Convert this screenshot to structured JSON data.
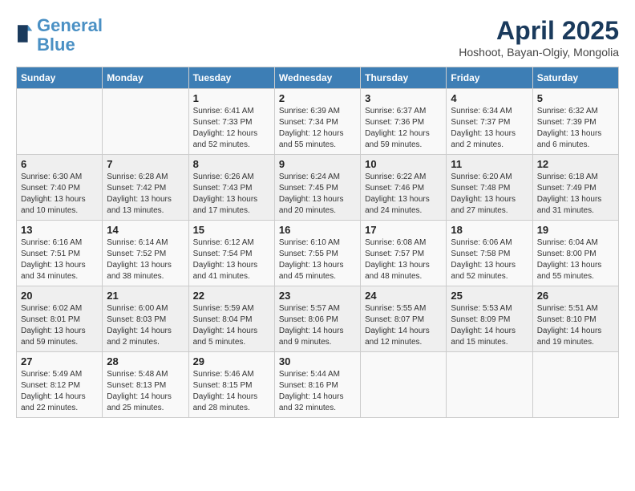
{
  "header": {
    "logo_line1": "General",
    "logo_line2": "Blue",
    "month": "April 2025",
    "location": "Hoshoot, Bayan-Olgiy, Mongolia"
  },
  "weekdays": [
    "Sunday",
    "Monday",
    "Tuesday",
    "Wednesday",
    "Thursday",
    "Friday",
    "Saturday"
  ],
  "weeks": [
    [
      {
        "day": "",
        "info": ""
      },
      {
        "day": "",
        "info": ""
      },
      {
        "day": "1",
        "info": "Sunrise: 6:41 AM\nSunset: 7:33 PM\nDaylight: 12 hours\nand 52 minutes."
      },
      {
        "day": "2",
        "info": "Sunrise: 6:39 AM\nSunset: 7:34 PM\nDaylight: 12 hours\nand 55 minutes."
      },
      {
        "day": "3",
        "info": "Sunrise: 6:37 AM\nSunset: 7:36 PM\nDaylight: 12 hours\nand 59 minutes."
      },
      {
        "day": "4",
        "info": "Sunrise: 6:34 AM\nSunset: 7:37 PM\nDaylight: 13 hours\nand 2 minutes."
      },
      {
        "day": "5",
        "info": "Sunrise: 6:32 AM\nSunset: 7:39 PM\nDaylight: 13 hours\nand 6 minutes."
      }
    ],
    [
      {
        "day": "6",
        "info": "Sunrise: 6:30 AM\nSunset: 7:40 PM\nDaylight: 13 hours\nand 10 minutes."
      },
      {
        "day": "7",
        "info": "Sunrise: 6:28 AM\nSunset: 7:42 PM\nDaylight: 13 hours\nand 13 minutes."
      },
      {
        "day": "8",
        "info": "Sunrise: 6:26 AM\nSunset: 7:43 PM\nDaylight: 13 hours\nand 17 minutes."
      },
      {
        "day": "9",
        "info": "Sunrise: 6:24 AM\nSunset: 7:45 PM\nDaylight: 13 hours\nand 20 minutes."
      },
      {
        "day": "10",
        "info": "Sunrise: 6:22 AM\nSunset: 7:46 PM\nDaylight: 13 hours\nand 24 minutes."
      },
      {
        "day": "11",
        "info": "Sunrise: 6:20 AM\nSunset: 7:48 PM\nDaylight: 13 hours\nand 27 minutes."
      },
      {
        "day": "12",
        "info": "Sunrise: 6:18 AM\nSunset: 7:49 PM\nDaylight: 13 hours\nand 31 minutes."
      }
    ],
    [
      {
        "day": "13",
        "info": "Sunrise: 6:16 AM\nSunset: 7:51 PM\nDaylight: 13 hours\nand 34 minutes."
      },
      {
        "day": "14",
        "info": "Sunrise: 6:14 AM\nSunset: 7:52 PM\nDaylight: 13 hours\nand 38 minutes."
      },
      {
        "day": "15",
        "info": "Sunrise: 6:12 AM\nSunset: 7:54 PM\nDaylight: 13 hours\nand 41 minutes."
      },
      {
        "day": "16",
        "info": "Sunrise: 6:10 AM\nSunset: 7:55 PM\nDaylight: 13 hours\nand 45 minutes."
      },
      {
        "day": "17",
        "info": "Sunrise: 6:08 AM\nSunset: 7:57 PM\nDaylight: 13 hours\nand 48 minutes."
      },
      {
        "day": "18",
        "info": "Sunrise: 6:06 AM\nSunset: 7:58 PM\nDaylight: 13 hours\nand 52 minutes."
      },
      {
        "day": "19",
        "info": "Sunrise: 6:04 AM\nSunset: 8:00 PM\nDaylight: 13 hours\nand 55 minutes."
      }
    ],
    [
      {
        "day": "20",
        "info": "Sunrise: 6:02 AM\nSunset: 8:01 PM\nDaylight: 13 hours\nand 59 minutes."
      },
      {
        "day": "21",
        "info": "Sunrise: 6:00 AM\nSunset: 8:03 PM\nDaylight: 14 hours\nand 2 minutes."
      },
      {
        "day": "22",
        "info": "Sunrise: 5:59 AM\nSunset: 8:04 PM\nDaylight: 14 hours\nand 5 minutes."
      },
      {
        "day": "23",
        "info": "Sunrise: 5:57 AM\nSunset: 8:06 PM\nDaylight: 14 hours\nand 9 minutes."
      },
      {
        "day": "24",
        "info": "Sunrise: 5:55 AM\nSunset: 8:07 PM\nDaylight: 14 hours\nand 12 minutes."
      },
      {
        "day": "25",
        "info": "Sunrise: 5:53 AM\nSunset: 8:09 PM\nDaylight: 14 hours\nand 15 minutes."
      },
      {
        "day": "26",
        "info": "Sunrise: 5:51 AM\nSunset: 8:10 PM\nDaylight: 14 hours\nand 19 minutes."
      }
    ],
    [
      {
        "day": "27",
        "info": "Sunrise: 5:49 AM\nSunset: 8:12 PM\nDaylight: 14 hours\nand 22 minutes."
      },
      {
        "day": "28",
        "info": "Sunrise: 5:48 AM\nSunset: 8:13 PM\nDaylight: 14 hours\nand 25 minutes."
      },
      {
        "day": "29",
        "info": "Sunrise: 5:46 AM\nSunset: 8:15 PM\nDaylight: 14 hours\nand 28 minutes."
      },
      {
        "day": "30",
        "info": "Sunrise: 5:44 AM\nSunset: 8:16 PM\nDaylight: 14 hours\nand 32 minutes."
      },
      {
        "day": "",
        "info": ""
      },
      {
        "day": "",
        "info": ""
      },
      {
        "day": "",
        "info": ""
      }
    ]
  ]
}
